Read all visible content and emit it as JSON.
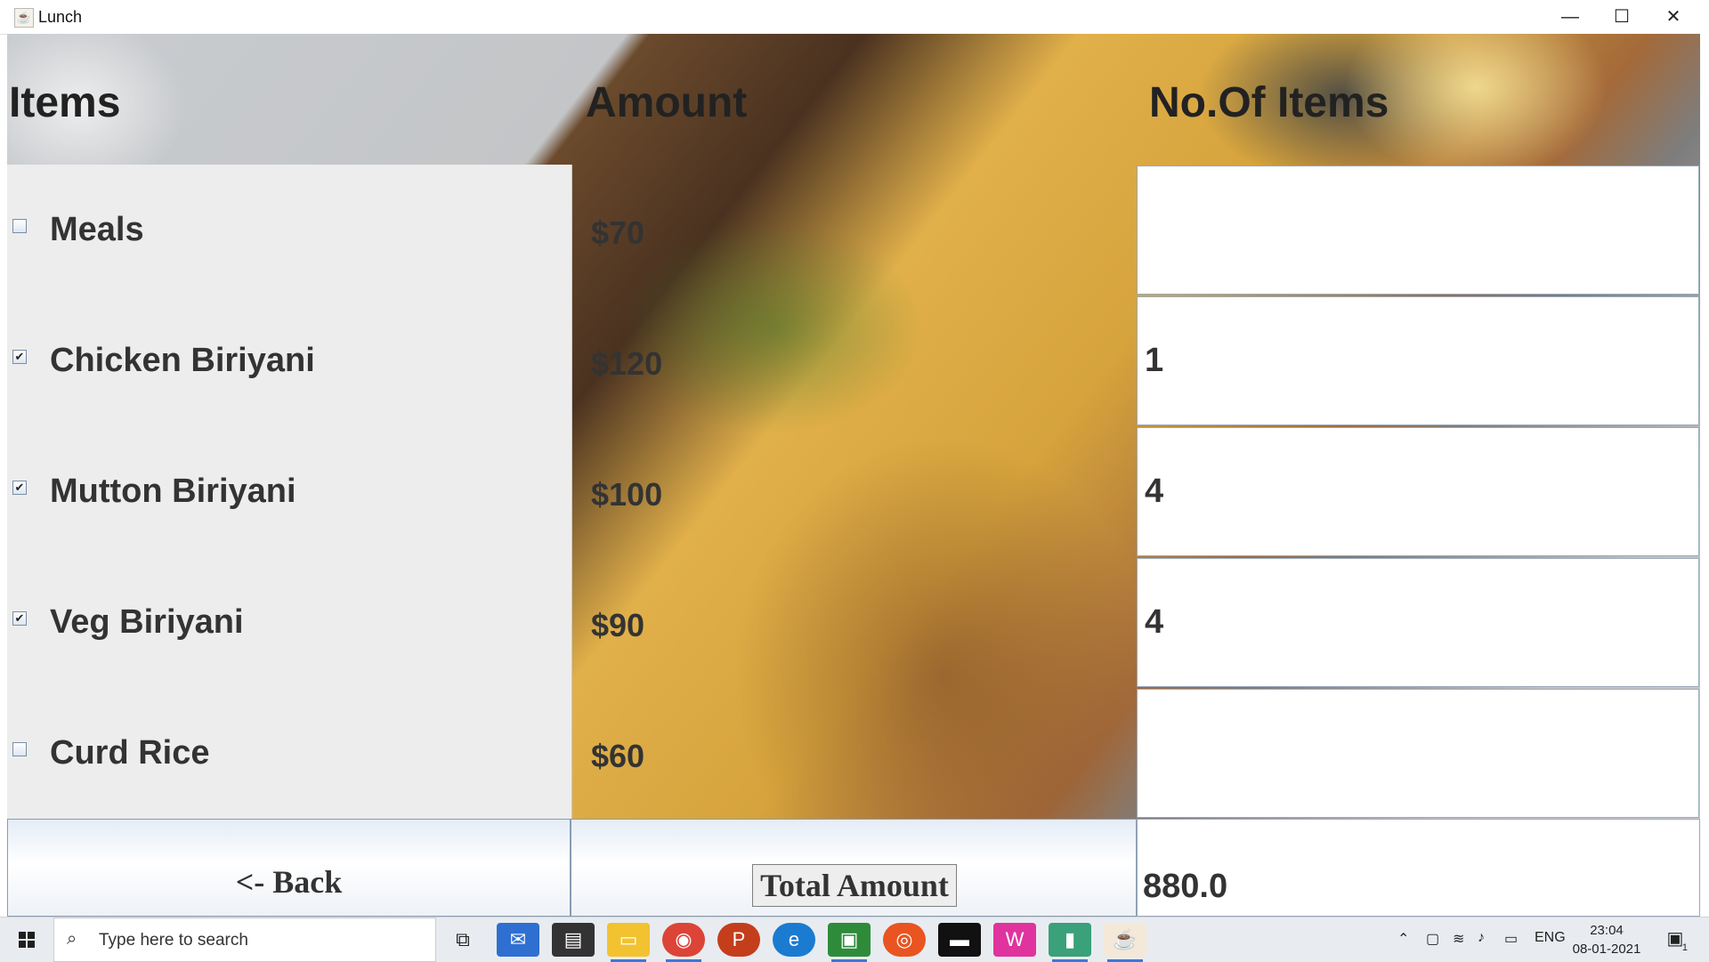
{
  "window": {
    "title": "Lunch",
    "controls": {
      "minimize": "—",
      "maximize": "☐",
      "close": "✕"
    }
  },
  "headers": {
    "items": "Items",
    "amount": "Amount",
    "count": "No.Of Items"
  },
  "rows": [
    {
      "name": "Meals",
      "price": "$70",
      "checked": false,
      "check": "",
      "qty": ""
    },
    {
      "name": "Chicken Biriyani",
      "price": "$120",
      "checked": true,
      "check": "✔",
      "qty": "1"
    },
    {
      "name": "Mutton Biriyani",
      "price": "$100",
      "checked": true,
      "check": "✔",
      "qty": "4"
    },
    {
      "name": "Veg Biriyani",
      "price": "$90",
      "checked": true,
      "check": "✔",
      "qty": "4"
    },
    {
      "name": "Curd Rice",
      "price": "$60",
      "checked": false,
      "check": "",
      "qty": ""
    }
  ],
  "footer": {
    "back_label": "<- Back",
    "total_label": "Total Amount",
    "total_value": "880.0"
  },
  "taskbar": {
    "search_placeholder": "Type here to search",
    "apps": [
      "task-view",
      "mail",
      "store",
      "file-explorer",
      "chrome",
      "powerpoint",
      "edge",
      "sublime",
      "ubuntu",
      "terminal",
      "winamp",
      "app",
      "java"
    ],
    "tray_lang": "ENG",
    "time": "23:04",
    "date": "08-01-2021",
    "notifications": "1"
  }
}
